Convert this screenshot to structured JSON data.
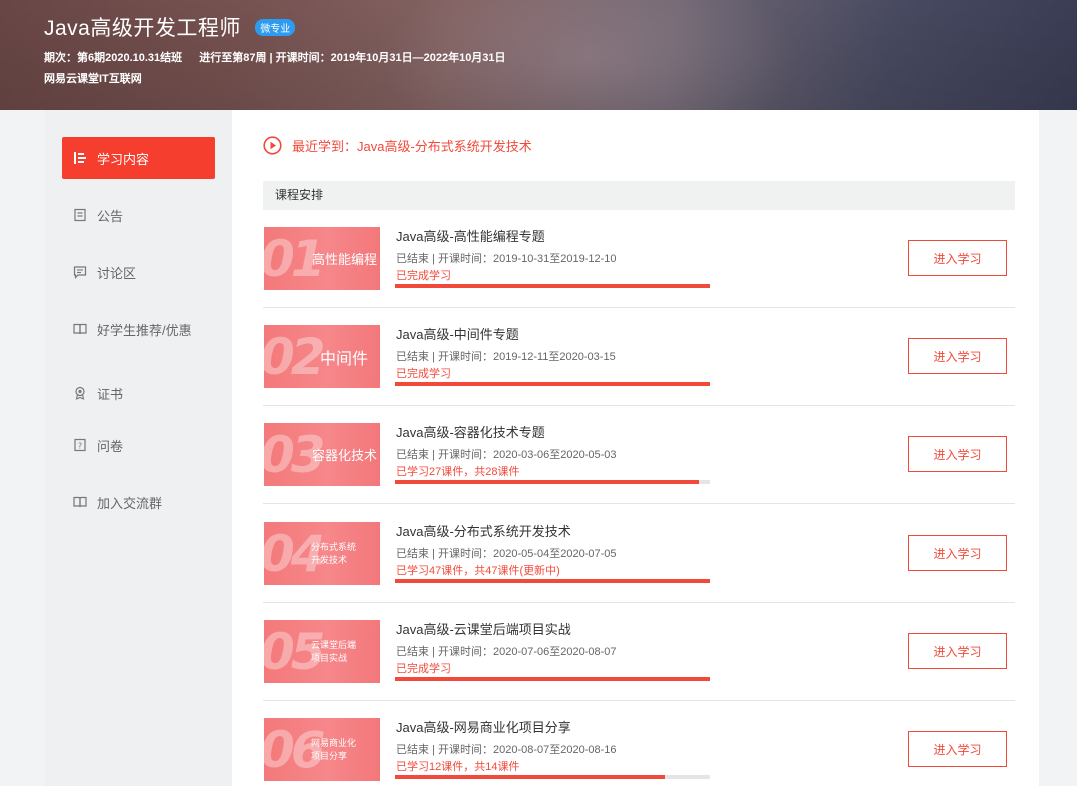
{
  "header": {
    "title": "Java高级开发工程师",
    "badge": "微专业",
    "period": "期次：第6期2020.10.31结班",
    "progress": "进行至第87周 | 开课时间：2019年10月31日—2022年10月31日",
    "school": "网易云课堂IT互联网"
  },
  "sidebar": {
    "items": [
      {
        "label": "学习内容",
        "icon": "content-list-icon",
        "active": true
      },
      {
        "label": "公告",
        "icon": "notice-icon",
        "active": false
      },
      {
        "label": "讨论区",
        "icon": "discussion-icon",
        "active": false
      },
      {
        "label": "好学生推荐/优惠",
        "icon": "book-icon",
        "active": false
      },
      {
        "label": "证书",
        "icon": "certificate-icon",
        "active": false
      },
      {
        "label": "问卷",
        "icon": "questionnaire-icon",
        "active": false
      },
      {
        "label": "加入交流群",
        "icon": "book-icon",
        "active": false
      }
    ]
  },
  "recent": {
    "text": "最近学到：Java高级-分布式系统开发技术",
    "icon": "play-circle-icon"
  },
  "section": {
    "title": "课程安排"
  },
  "colors": {
    "accent": "#f24a3a",
    "active_nav": "#f53e2e",
    "badge": "#2d9cf0"
  },
  "courses": [
    {
      "num": "01",
      "thumb_lines": [
        "高性能编程"
      ],
      "title": "Java高级-高性能编程专题",
      "time": "已结束 | 开课时间：2019-10-31至2019-12-10",
      "status": "已完成学习",
      "progress": 1.0,
      "button": "进入学习"
    },
    {
      "num": "02",
      "thumb_lines": [
        "中间件"
      ],
      "title": "Java高级-中间件专题",
      "time": "已结束 | 开课时间：2019-12-11至2020-03-15",
      "status": "已完成学习",
      "progress": 1.0,
      "button": "进入学习"
    },
    {
      "num": "03",
      "thumb_lines": [
        "容器化技术"
      ],
      "title": "Java高级-容器化技术专题",
      "time": "已结束 | 开课时间：2020-03-06至2020-05-03",
      "status": "已学习27课件，共28课件",
      "progress": 0.964,
      "button": "进入学习"
    },
    {
      "num": "04",
      "thumb_lines": [
        "分布式系统",
        "开发技术"
      ],
      "title": "Java高级-分布式系统开发技术",
      "time": "已结束 | 开课时间：2020-05-04至2020-07-05",
      "status": "已学习47课件，共47课件(更新中)",
      "progress": 1.0,
      "button": "进入学习"
    },
    {
      "num": "05",
      "thumb_lines": [
        "云课堂后端",
        "项目实战"
      ],
      "title": "Java高级-云课堂后端项目实战",
      "time": "已结束 | 开课时间：2020-07-06至2020-08-07",
      "status": "已完成学习",
      "progress": 1.0,
      "button": "进入学习"
    },
    {
      "num": "06",
      "thumb_lines": [
        "网易商业化",
        "项目分享"
      ],
      "title": "Java高级-网易商业化项目分享",
      "time": "已结束 | 开课时间：2020-08-07至2020-08-16",
      "status": "已学习12课件，共14课件",
      "progress": 0.857,
      "button": "进入学习"
    }
  ]
}
